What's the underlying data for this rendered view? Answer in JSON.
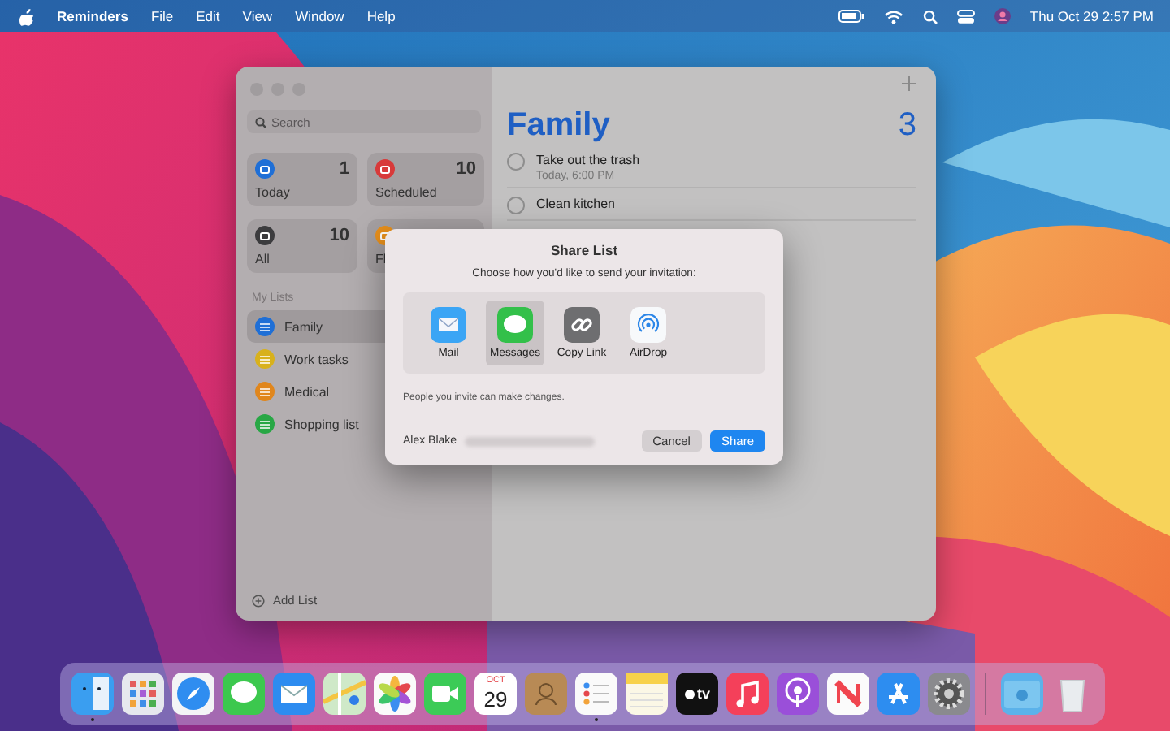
{
  "menubar": {
    "app": "Reminders",
    "menus": [
      "File",
      "Edit",
      "View",
      "Window",
      "Help"
    ],
    "clock": "Thu Oct 29  2:57 PM"
  },
  "window": {
    "search": {
      "placeholder": "Search"
    },
    "smart_lists": [
      {
        "label": "Today",
        "count": "1",
        "color": "#1f6fd6"
      },
      {
        "label": "Scheduled",
        "count": "10",
        "color": "#d83a3a"
      },
      {
        "label": "All",
        "count": "10",
        "color": "#3c3c3e"
      },
      {
        "label": "Fl",
        "color": "#e8901c"
      }
    ],
    "my_lists_heading": "My Lists",
    "lists": [
      {
        "name": "Family",
        "color": "#1f6fd6",
        "selected": true
      },
      {
        "name": "Work tasks",
        "color": "#d8b11c",
        "selected": false
      },
      {
        "name": "Medical",
        "color": "#e0861c",
        "selected": false
      },
      {
        "name": "Shopping list",
        "color": "#28a745",
        "selected": false
      }
    ],
    "add_list": "Add List",
    "title": "Family",
    "count": "3",
    "reminders": [
      {
        "title": "Take out the trash",
        "due": "Today, 6:00 PM",
        "checked": false
      },
      {
        "title": "Clean kitchen",
        "checked": false
      }
    ]
  },
  "dialog": {
    "title": "Share List",
    "prompt": "Choose how you'd like to send your invitation:",
    "options": [
      {
        "label": "Mail",
        "kind": "mail",
        "selected": false
      },
      {
        "label": "Messages",
        "kind": "messages",
        "selected": true
      },
      {
        "label": "Copy Link",
        "kind": "link",
        "selected": false
      },
      {
        "label": "AirDrop",
        "kind": "airdrop",
        "selected": false
      }
    ],
    "note": "People you invite can make changes.",
    "sender": "Alex Blake",
    "buttons": [
      {
        "label": "Cancel",
        "kind": "secondary"
      },
      {
        "label": "Share",
        "kind": "primary"
      }
    ]
  },
  "dock": {
    "apps": [
      {
        "kind": "finder",
        "running": true
      },
      {
        "kind": "launchpad",
        "running": false
      },
      {
        "kind": "safari",
        "running": false
      },
      {
        "kind": "messages",
        "running": false
      },
      {
        "kind": "mail",
        "running": false
      },
      {
        "kind": "maps",
        "running": false
      },
      {
        "kind": "photos",
        "running": false
      },
      {
        "kind": "facetime",
        "running": false
      },
      {
        "kind": "calendar",
        "running": false,
        "month": "OCT",
        "day": "29"
      },
      {
        "kind": "contacts",
        "running": false
      },
      {
        "kind": "reminders",
        "running": true
      },
      {
        "kind": "notes",
        "running": false
      },
      {
        "kind": "tv",
        "running": false,
        "label": "tv"
      },
      {
        "kind": "music",
        "running": false
      },
      {
        "kind": "podcasts",
        "running": false
      },
      {
        "kind": "news",
        "running": false
      },
      {
        "kind": "appstore",
        "running": false
      },
      {
        "kind": "settings",
        "running": false
      }
    ],
    "stacks": [
      {
        "kind": "downloads"
      },
      {
        "kind": "trash"
      }
    ]
  }
}
